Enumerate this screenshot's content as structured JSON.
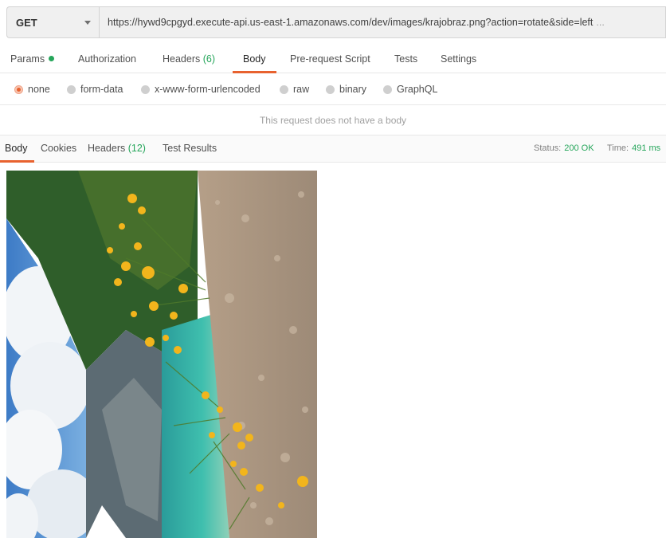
{
  "request": {
    "method": "GET",
    "url": "https://hywd9cpgyd.execute-api.us-east-1.amazonaws.com/dev/images/krajobraz.png?action=rotate&side=left",
    "url_overflow": "..."
  },
  "request_tabs": [
    {
      "label": "Params",
      "indicator": "green-dot"
    },
    {
      "label": "Authorization"
    },
    {
      "label": "Headers",
      "count": "(6)"
    },
    {
      "label": "Body",
      "active": true
    },
    {
      "label": "Pre-request Script"
    },
    {
      "label": "Tests"
    },
    {
      "label": "Settings"
    }
  ],
  "body_types": [
    {
      "label": "none",
      "selected": true
    },
    {
      "label": "form-data"
    },
    {
      "label": "x-www-form-urlencoded"
    },
    {
      "label": "raw"
    },
    {
      "label": "binary"
    },
    {
      "label": "GraphQL"
    }
  ],
  "no_body_message": "This request does not have a body",
  "response_tabs": [
    {
      "label": "Body",
      "active": true
    },
    {
      "label": "Cookies"
    },
    {
      "label": "Headers",
      "count": "(12)"
    },
    {
      "label": "Test Results"
    }
  ],
  "response": {
    "status_label": "Status:",
    "status_value": "200 OK",
    "time_label": "Time:",
    "time_value": "491 ms"
  },
  "colors": {
    "accent": "#e8622f",
    "success": "#26a65b"
  }
}
